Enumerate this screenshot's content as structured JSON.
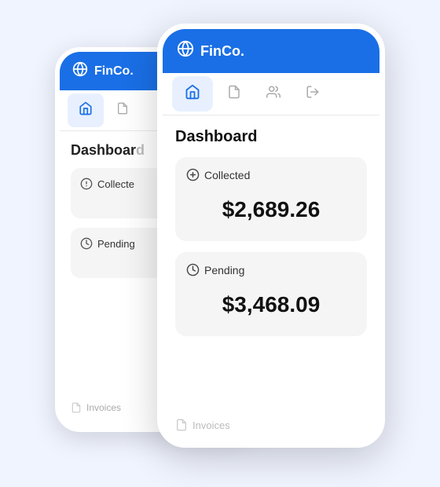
{
  "app": {
    "name": "FinCo.",
    "header_bg": "#1a6fe6"
  },
  "nav": {
    "items": [
      {
        "id": "home",
        "label": "Home",
        "active": true
      },
      {
        "id": "documents",
        "label": "Documents",
        "active": false
      },
      {
        "id": "users",
        "label": "Users",
        "active": false
      },
      {
        "id": "logout",
        "label": "Logout",
        "active": false
      }
    ]
  },
  "dashboard": {
    "title": "Dashboard",
    "cards": [
      {
        "id": "collected",
        "label": "Collected",
        "value": "$2,689.26",
        "icon": "dollar"
      },
      {
        "id": "pending",
        "label": "Pending",
        "value": "$3,468.09",
        "icon": "clock"
      }
    ]
  },
  "bottom_nav": {
    "invoices_label": "Invoices"
  }
}
